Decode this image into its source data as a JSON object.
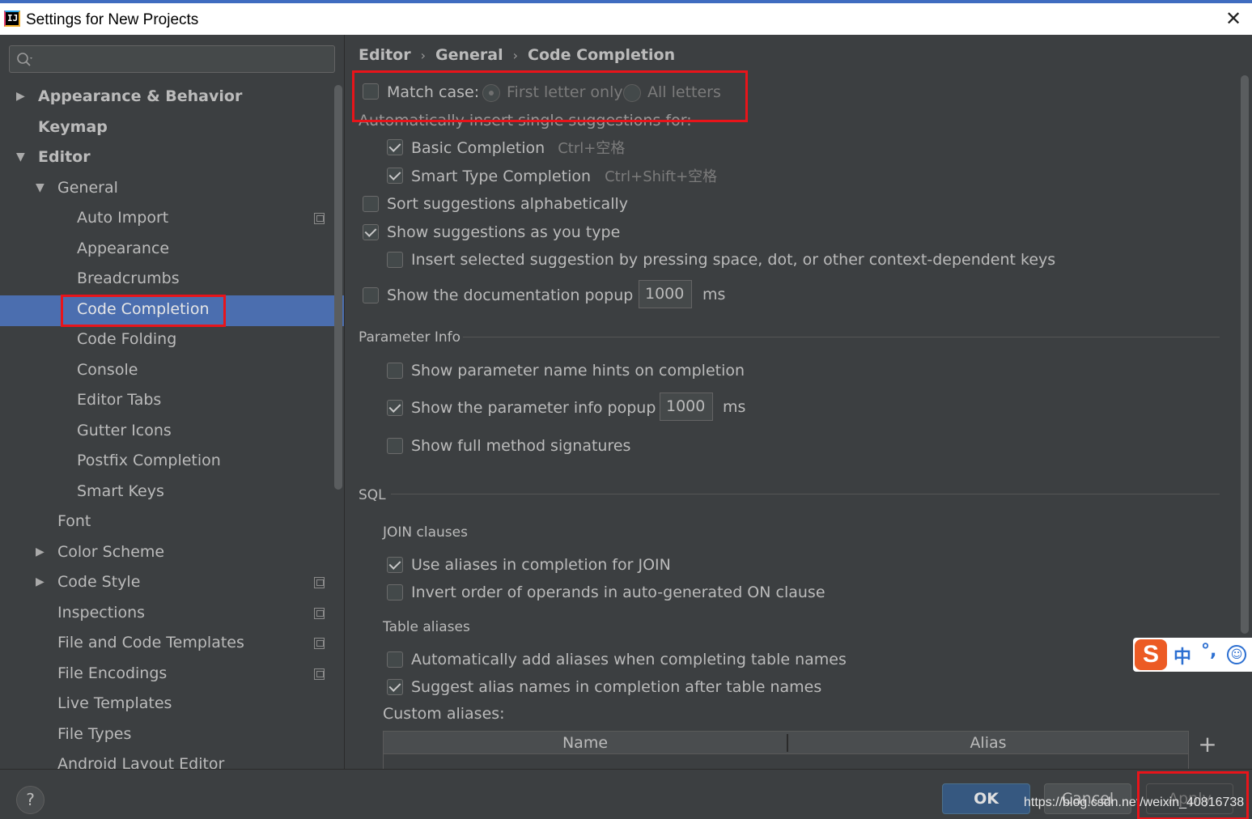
{
  "window": {
    "title": "Settings for New Projects",
    "close_glyph": "✕"
  },
  "sidebar": {
    "search_placeholder": "",
    "items": [
      {
        "label": "Appearance & Behavior"
      },
      {
        "label": "Keymap"
      },
      {
        "label": "Editor"
      },
      {
        "label": "General"
      },
      {
        "label": "Auto Import"
      },
      {
        "label": "Appearance"
      },
      {
        "label": "Breadcrumbs"
      },
      {
        "label": "Code Completion"
      },
      {
        "label": "Code Folding"
      },
      {
        "label": "Console"
      },
      {
        "label": "Editor Tabs"
      },
      {
        "label": "Gutter Icons"
      },
      {
        "label": "Postfix Completion"
      },
      {
        "label": "Smart Keys"
      },
      {
        "label": "Font"
      },
      {
        "label": "Color Scheme"
      },
      {
        "label": "Code Style"
      },
      {
        "label": "Inspections"
      },
      {
        "label": "File and Code Templates"
      },
      {
        "label": "File Encodings"
      },
      {
        "label": "Live Templates"
      },
      {
        "label": "File Types"
      },
      {
        "label": "Android Layout Editor"
      }
    ],
    "selected": "Code Completion"
  },
  "breadcrumb": [
    "Editor",
    "General",
    "Code Completion"
  ],
  "breadcrumb_sep": "›",
  "main": {
    "match_case": {
      "label": "Match case:",
      "checked": false,
      "options": [
        "First letter only",
        "All letters"
      ],
      "selected": "First letter only"
    },
    "auto_insert_label": "Automatically insert single suggestions for:",
    "basic_completion": {
      "label": "Basic Completion",
      "shortcut": "Ctrl+空格",
      "checked": true
    },
    "smart_type_completion": {
      "label": "Smart Type Completion",
      "shortcut": "Ctrl+Shift+空格",
      "checked": true
    },
    "sort_alpha": {
      "label": "Sort suggestions alphabetically",
      "checked": false
    },
    "show_as_you_type": {
      "label": "Show suggestions as you type",
      "checked": true
    },
    "insert_selected": {
      "label": "Insert selected suggestion by pressing space, dot, or other context-dependent keys",
      "checked": false
    },
    "doc_popup": {
      "label": "Show the documentation popup in",
      "value": "1000",
      "unit": "ms",
      "checked": false
    },
    "parameter_info": {
      "title": "Parameter Info",
      "name_hints": {
        "label": "Show parameter name hints on completion",
        "checked": false
      },
      "info_popup": {
        "label": "Show the parameter info popup in",
        "value": "1000",
        "unit": "ms",
        "checked": true
      },
      "full_signatures": {
        "label": "Show full method signatures",
        "checked": false
      }
    },
    "sql": {
      "title": "SQL",
      "join_title": "JOIN clauses",
      "use_aliases_join": {
        "label": "Use aliases in completion for JOIN",
        "checked": true
      },
      "invert_order": {
        "label": "Invert order of operands in auto-generated ON clause",
        "checked": false
      },
      "table_aliases_title": "Table aliases",
      "auto_add_aliases": {
        "label": "Automatically add aliases when completing table names",
        "checked": false
      },
      "suggest_alias_names": {
        "label": "Suggest alias names in completion after table names",
        "checked": true
      },
      "custom_aliases_label": "Custom aliases:",
      "table_columns": [
        "Name",
        "Alias"
      ],
      "add_glyph": "+"
    }
  },
  "footer": {
    "help_glyph": "?",
    "ok": "OK",
    "cancel": "Cancel",
    "apply": "Apply",
    "watermark": "https://blog.csdn.net/weixin_40816738"
  },
  "ime": {
    "logo": "S",
    "mode": "中",
    "punct": "°,",
    "emoji": "☺"
  },
  "colors": {
    "accent_selected": "#4b6eaf",
    "highlight_box": "#e8141a",
    "ok_button": "#365880"
  }
}
